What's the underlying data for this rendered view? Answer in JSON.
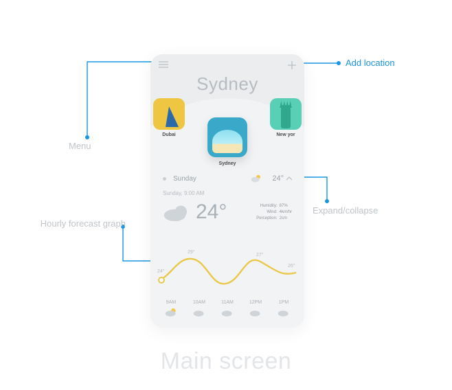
{
  "title": "Sydney",
  "footer": "Main screen",
  "annotations": {
    "menu": "Menu",
    "add": "Add location",
    "expand": "Expand/collapse",
    "graph": "Hourly forecast graph"
  },
  "cities": {
    "left": {
      "label": "Dubai"
    },
    "center": {
      "label": "Sydney"
    },
    "right": {
      "label": "New yor"
    }
  },
  "day": {
    "name": "Sunday",
    "temp": "24°"
  },
  "now": {
    "time": "Sunday, 9:00 AM",
    "temp": "24°",
    "humidity_lbl": "Humidity:",
    "humidity": "87%",
    "wind_lbl": "Wind:",
    "wind": "4km/hr",
    "precip_lbl": "Perception:",
    "precip": "2cm"
  },
  "chart_data": {
    "type": "line",
    "title": "",
    "xlabel": "",
    "ylabel": "",
    "x": [
      "9AM",
      "10AM",
      "11AM",
      "12PM",
      "1PM"
    ],
    "values": [
      24,
      29,
      23,
      27,
      26
    ],
    "point_labels": [
      "24°",
      "29°",
      "",
      "27°",
      "26°"
    ],
    "ylim": [
      20,
      32
    ]
  },
  "hours": [
    {
      "t": "9AM",
      "icon": "cloud-sun"
    },
    {
      "t": "10AM",
      "icon": "cloud"
    },
    {
      "t": "11AM",
      "icon": "cloud"
    },
    {
      "t": "12PM",
      "icon": "cloud"
    },
    {
      "t": "1PM",
      "icon": "cloud"
    }
  ]
}
